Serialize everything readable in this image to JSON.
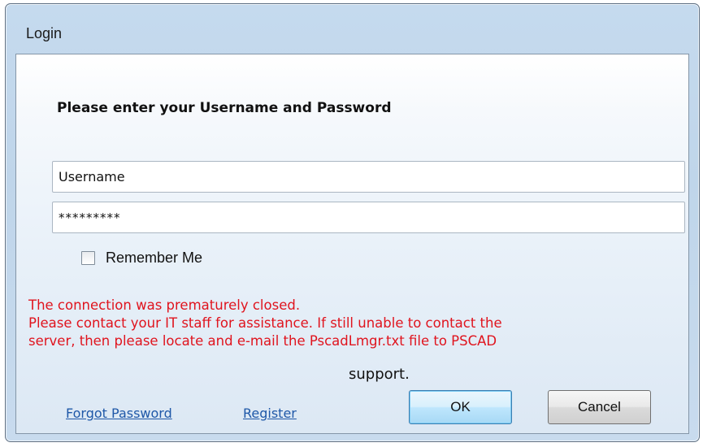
{
  "window": {
    "title": "Login"
  },
  "form": {
    "instructions": "Please enter your Username and Password",
    "username_value": "Username",
    "password_value": "*********",
    "remember_label": "Remember Me",
    "remember_checked": false
  },
  "error": {
    "lines": [
      "The connection was prematurely closed.",
      "Please contact your IT staff for assistance. If still unable to contact the",
      "server, then please locate and e-mail the PscadLmgr.txt file to PSCAD"
    ],
    "support": "support.",
    "color": "#e0141e"
  },
  "links": {
    "forgot_password": "Forgot Password",
    "register": "Register"
  },
  "buttons": {
    "ok": "OK",
    "cancel": "Cancel"
  }
}
